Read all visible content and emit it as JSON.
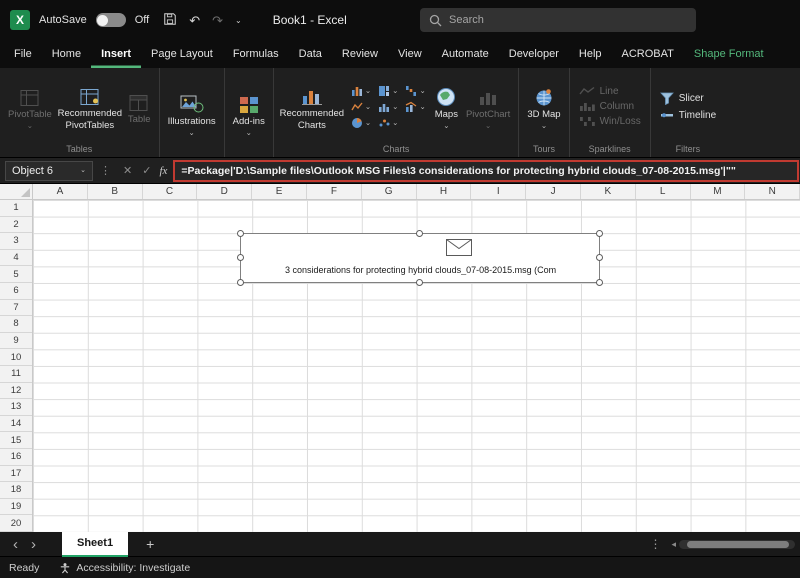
{
  "colors": {
    "excel_green": "#21a366",
    "contextual_tab_green": "#54b87c",
    "active_tab_underline": "#54b87c",
    "formula_highlight_red": "#c13a31"
  },
  "titlebar": {
    "autosave_label": "AutoSave",
    "autosave_state": "Off",
    "document_title": "Book1 - Excel",
    "search_placeholder": "Search"
  },
  "tabs": [
    {
      "label": "File"
    },
    {
      "label": "Home"
    },
    {
      "label": "Insert",
      "active": true
    },
    {
      "label": "Page Layout"
    },
    {
      "label": "Formulas"
    },
    {
      "label": "Data"
    },
    {
      "label": "Review"
    },
    {
      "label": "View"
    },
    {
      "label": "Automate"
    },
    {
      "label": "Developer"
    },
    {
      "label": "Help"
    },
    {
      "label": "ACROBAT"
    },
    {
      "label": "Shape Format",
      "contextual": true
    }
  ],
  "ribbon": {
    "tables": {
      "group_label": "Tables",
      "pivottable": "PivotTable",
      "pivottable_disabled": true,
      "recommended_pivottables": "Recommended PivotTables",
      "table": "Table",
      "table_disabled": true
    },
    "illustrations": {
      "label": "Illustrations"
    },
    "addins": {
      "label": "Add-ins"
    },
    "charts": {
      "group_label": "Charts",
      "recommended_charts": "Recommended Charts",
      "maps": "Maps",
      "pivotchart": "PivotChart",
      "pivotchart_disabled": true
    },
    "tours": {
      "group_label": "Tours",
      "map_3d": "3D Map"
    },
    "sparklines": {
      "group_label": "Sparklines",
      "line": "Line",
      "column": "Column",
      "win_loss": "Win/Loss",
      "disabled": true
    },
    "filters": {
      "group_label": "Filters",
      "slicer": "Slicer",
      "timeline": "Timeline"
    }
  },
  "formula_bar": {
    "name_box": "Object 6",
    "fx_label": "fx",
    "formula": "=Package|'D:\\Sample files\\Outlook MSG Files\\3 considerations for protecting hybrid clouds_07-08-2015.msg'|\"\""
  },
  "grid": {
    "columns": [
      "A",
      "B",
      "C",
      "D",
      "E",
      "F",
      "G",
      "H",
      "I",
      "J",
      "K",
      "L",
      "M",
      "N"
    ],
    "rows": [
      "1",
      "2",
      "3",
      "4",
      "5",
      "6",
      "7",
      "8",
      "9",
      "10",
      "11",
      "12",
      "13",
      "14",
      "15",
      "16",
      "17",
      "18",
      "19",
      "20"
    ]
  },
  "embedded_object": {
    "label": "3 considerations for protecting hybrid clouds_07-08-2015.msg (Com"
  },
  "sheet_bar": {
    "active_sheet": "Sheet1"
  },
  "status_bar": {
    "mode": "Ready",
    "accessibility": "Accessibility: Investigate"
  }
}
